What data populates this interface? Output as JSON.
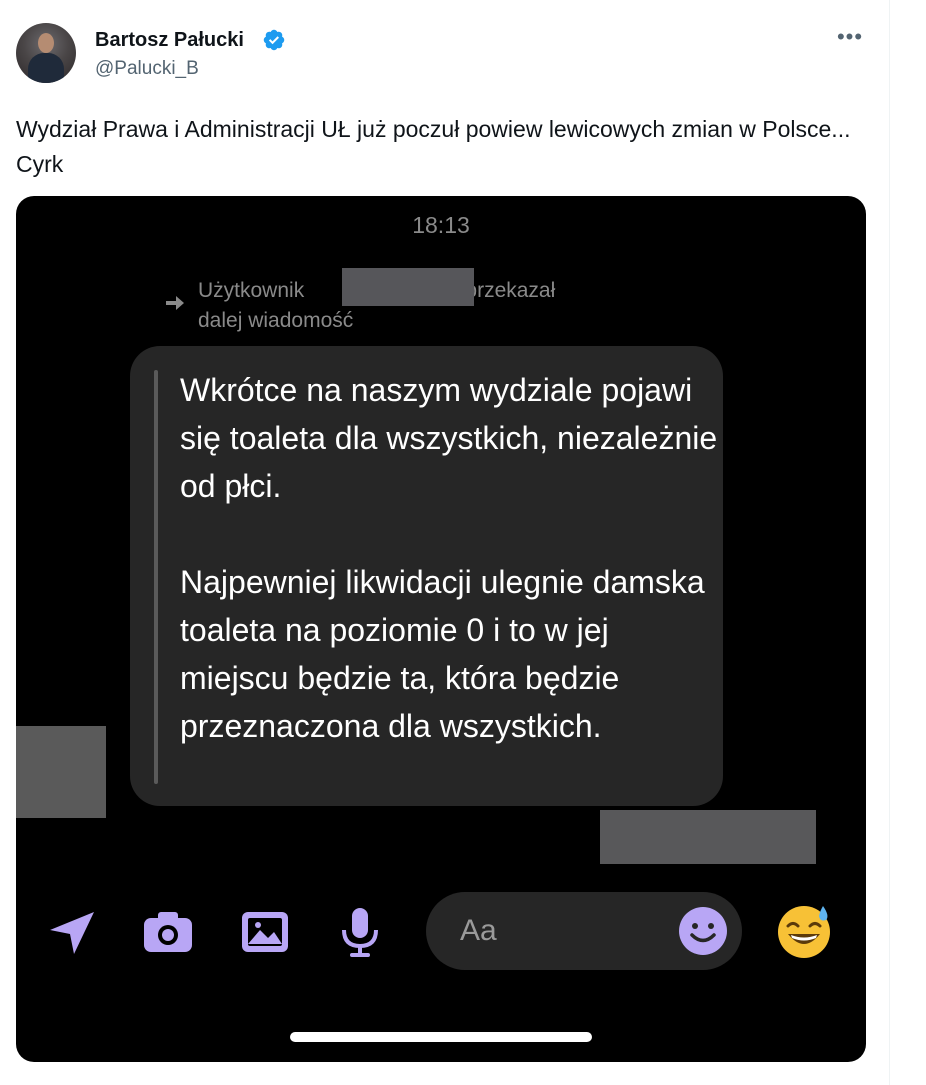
{
  "author": {
    "name": "Bartosz Pałucki",
    "handle": "@Palucki_B",
    "verified": true
  },
  "more_label": "•••",
  "tweet": {
    "text": "Wydział Prawa i Administracji UŁ już poczuł powiew lewicowych zmian w Polsce... Cyrk"
  },
  "screenshot": {
    "time": "18:13",
    "forwarded": {
      "line1_prefix": "Użytkownik",
      "line1_suffix": "a przekazał",
      "line2": "dalej wiadomość"
    },
    "message": {
      "paragraph1": "Wkrótce na naszym wydziale pojawi się toaleta dla wszystkich, niezależnie od płci.",
      "paragraph2": "Najpewniej likwidacji ulegnie damska toaleta na poziomie 0 i to w jej miejscu będzie ta, która będzie przeznaczona dla wszystkich."
    },
    "composer": {
      "placeholder": "Aa"
    },
    "icons": [
      "send-icon",
      "camera-icon",
      "gallery-icon",
      "microphone-icon",
      "emoji-icon",
      "grinning-sweat-emoji-icon"
    ],
    "accent_color": "#b8a6f5"
  }
}
